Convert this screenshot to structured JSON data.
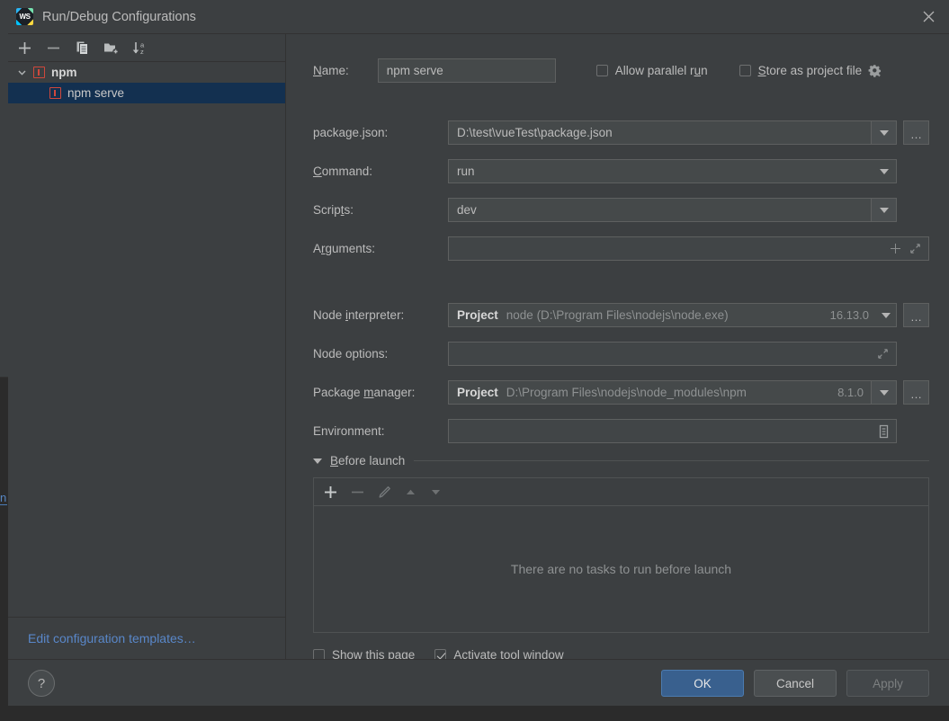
{
  "window": {
    "title": "Run/Debug Configurations",
    "logo_text": "WS",
    "logo_icon": "webstorm-logo",
    "close_icon": "close-icon"
  },
  "sidebar": {
    "toolbar": [
      {
        "name": "add-configuration-button",
        "icon": "plus-icon"
      },
      {
        "name": "remove-configuration-button",
        "icon": "minus-icon"
      },
      {
        "name": "copy-configuration-button",
        "icon": "copy-icon"
      },
      {
        "name": "new-folder-button",
        "icon": "folder-plus-icon"
      },
      {
        "name": "sort-configurations-button",
        "icon": "sort-az-icon"
      }
    ],
    "tree": {
      "group": {
        "label": "npm",
        "icon": "npm-icon",
        "expanded": true,
        "chevron": "chevron-down-icon"
      },
      "children": [
        {
          "label": "npm serve",
          "icon": "npm-icon",
          "selected": true
        }
      ]
    },
    "templates_link": "Edit configuration templates…"
  },
  "form": {
    "name": {
      "label": "Name:",
      "label_mnemonic": "N",
      "value": "npm serve",
      "placeholder": ""
    },
    "allow_parallel_run": {
      "label": "Allow parallel run",
      "checked": false
    },
    "store_as_project_file": {
      "label": "Store as project file",
      "checked": false,
      "gear_icon": "gear-icon"
    },
    "package_json": {
      "label": "package.json:",
      "value": "D:\\test\\vueTest\\package.json",
      "dropdown_icon": "chevron-down-icon",
      "browse_label": "…"
    },
    "command": {
      "label": "Command:",
      "label_mnemonic": "C",
      "value": "run",
      "dropdown_icon": "chevron-down-icon"
    },
    "scripts": {
      "label": "Scripts:",
      "label_mnemonic": "t",
      "value": "dev",
      "dropdown_icon": "chevron-down-icon"
    },
    "arguments": {
      "label": "Arguments:",
      "label_mnemonic": "r",
      "value": "",
      "add_icon": "plus-icon",
      "expand_icon": "expand-icon"
    },
    "node_interpreter": {
      "label": "Node interpreter:",
      "label_mnemonic": "i",
      "scope": "Project",
      "value": "node (D:\\Program Files\\nodejs\\node.exe)",
      "version": "16.13.0",
      "dropdown_icon": "chevron-down-icon",
      "browse_label": "…"
    },
    "node_options": {
      "label": "Node options:",
      "value": "",
      "expand_icon": "expand-icon"
    },
    "package_manager": {
      "label": "Package manager:",
      "label_mnemonic": "m",
      "scope": "Project",
      "value": "D:\\Program Files\\nodejs\\node_modules\\npm",
      "version": "8.1.0",
      "dropdown_icon": "chevron-down-icon",
      "browse_label": "…"
    },
    "environment": {
      "label": "Environment:",
      "value": "",
      "editor_icon": "env-variables-icon"
    }
  },
  "before_launch": {
    "title": "Before launch",
    "title_mnemonic": "B",
    "expanded": true,
    "collapse_icon": "triangle-down-icon",
    "toolbar": [
      {
        "name": "add-task-button",
        "icon": "plus-icon",
        "enabled": true
      },
      {
        "name": "remove-task-button",
        "icon": "minus-icon",
        "enabled": false
      },
      {
        "name": "edit-task-button",
        "icon": "pencil-icon",
        "enabled": false
      },
      {
        "name": "move-task-up-button",
        "icon": "triangle-up-icon",
        "enabled": false
      },
      {
        "name": "move-task-down-button",
        "icon": "triangle-down-icon",
        "enabled": false
      }
    ],
    "empty_text": "There are no tasks to run before launch"
  },
  "bottom_options": {
    "show_this_page": {
      "label": "Show this page",
      "checked": false
    },
    "activate_tool_window": {
      "label": "Activate tool window",
      "checked": true
    }
  },
  "footer": {
    "help_label": "?",
    "ok": "OK",
    "cancel": "Cancel",
    "apply": "Apply",
    "apply_enabled": false
  },
  "colors": {
    "dialog_background": "#3c3f41",
    "field_background": "#45494a",
    "selection_blue": "#133050",
    "primary_button": "#39608e",
    "link_blue": "#5987c9",
    "npm_red": "#d0483c",
    "text": "#bbbbbb",
    "dim_text": "#8e9192"
  }
}
